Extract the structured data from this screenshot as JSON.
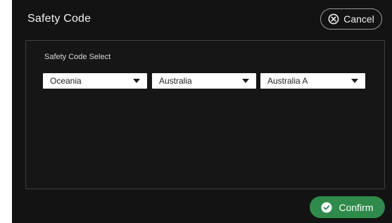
{
  "dialog": {
    "title": "Safety Code",
    "cancel_label": "Cancel",
    "confirm_label": "Confirm"
  },
  "selection": {
    "label": "Safety Code  Select",
    "region": "Oceania",
    "country": "Australia",
    "code": "Australia A"
  },
  "icons": {
    "cancel": "close-circle-icon",
    "confirm": "check-circle-icon",
    "dropdown": "caret-down-icon"
  },
  "colors": {
    "background": "#131313",
    "confirm_green": "#2f8a4c"
  }
}
